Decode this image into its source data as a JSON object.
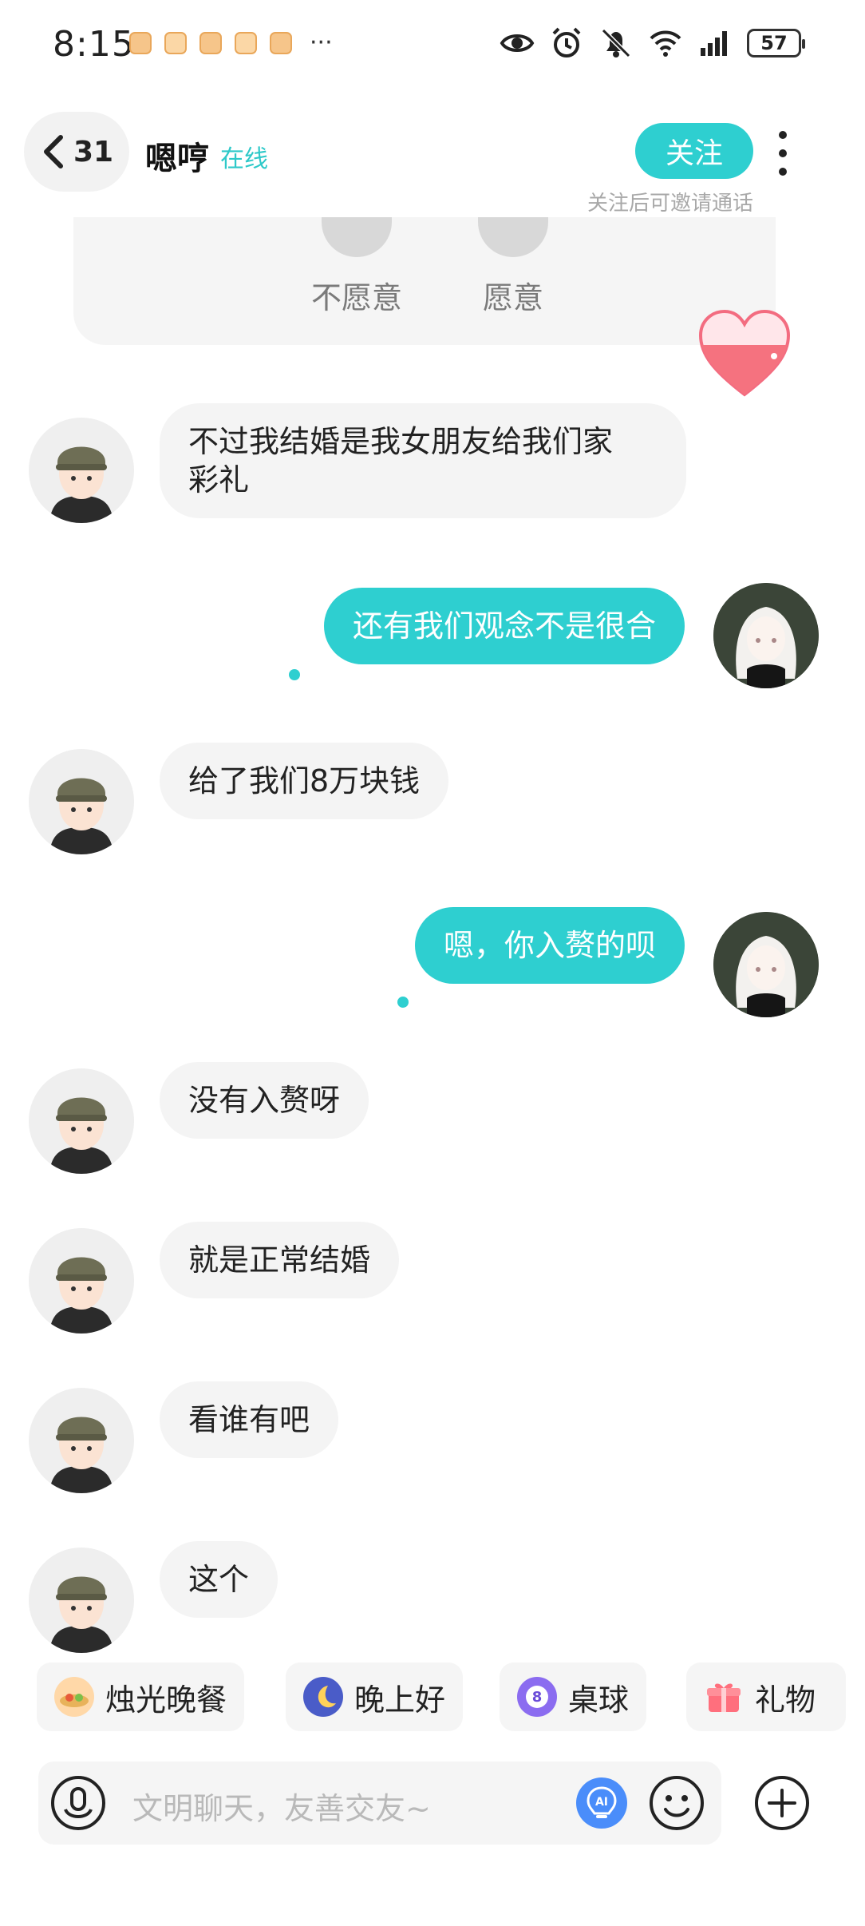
{
  "status_bar": {
    "time": "8:15",
    "more_notifications": "···",
    "battery": "57"
  },
  "header": {
    "back_count": "31",
    "title": "嗯哼",
    "status": "在线",
    "follow_label": "关注",
    "follow_hint": "关注后可邀请通话"
  },
  "survey": {
    "option_no": "不愿意",
    "option_yes": "愿意"
  },
  "messages": [
    {
      "from": "other",
      "text_line1": "不过我结婚是我女朋友给我们家",
      "text_line2": "彩礼"
    },
    {
      "from": "me",
      "text": "还有我们观念不是很合"
    },
    {
      "from": "other",
      "text": "给了我们8万块钱"
    },
    {
      "from": "me",
      "text": "嗯，你入赘的呗"
    },
    {
      "from": "other",
      "text": "没有入赘呀"
    },
    {
      "from": "other",
      "text": "就是正常结婚"
    },
    {
      "from": "other",
      "text": "看谁有吧"
    },
    {
      "from": "other",
      "text": "这个"
    }
  ],
  "quick_actions": [
    {
      "label": "烛光晚餐",
      "icon": "candle-dinner-icon"
    },
    {
      "label": "晚上好",
      "icon": "moon-icon"
    },
    {
      "label": "桌球",
      "icon": "billiard-ball-icon",
      "icon_text": "8"
    },
    {
      "label": "礼物",
      "icon": "gift-icon"
    }
  ],
  "input": {
    "placeholder": "文明聊天，友善交友~",
    "ai_label": "AI"
  },
  "colors": {
    "accent": "#2ecfd0",
    "bubble_in": "#f4f4f4",
    "hint": "#a8a8a8"
  }
}
